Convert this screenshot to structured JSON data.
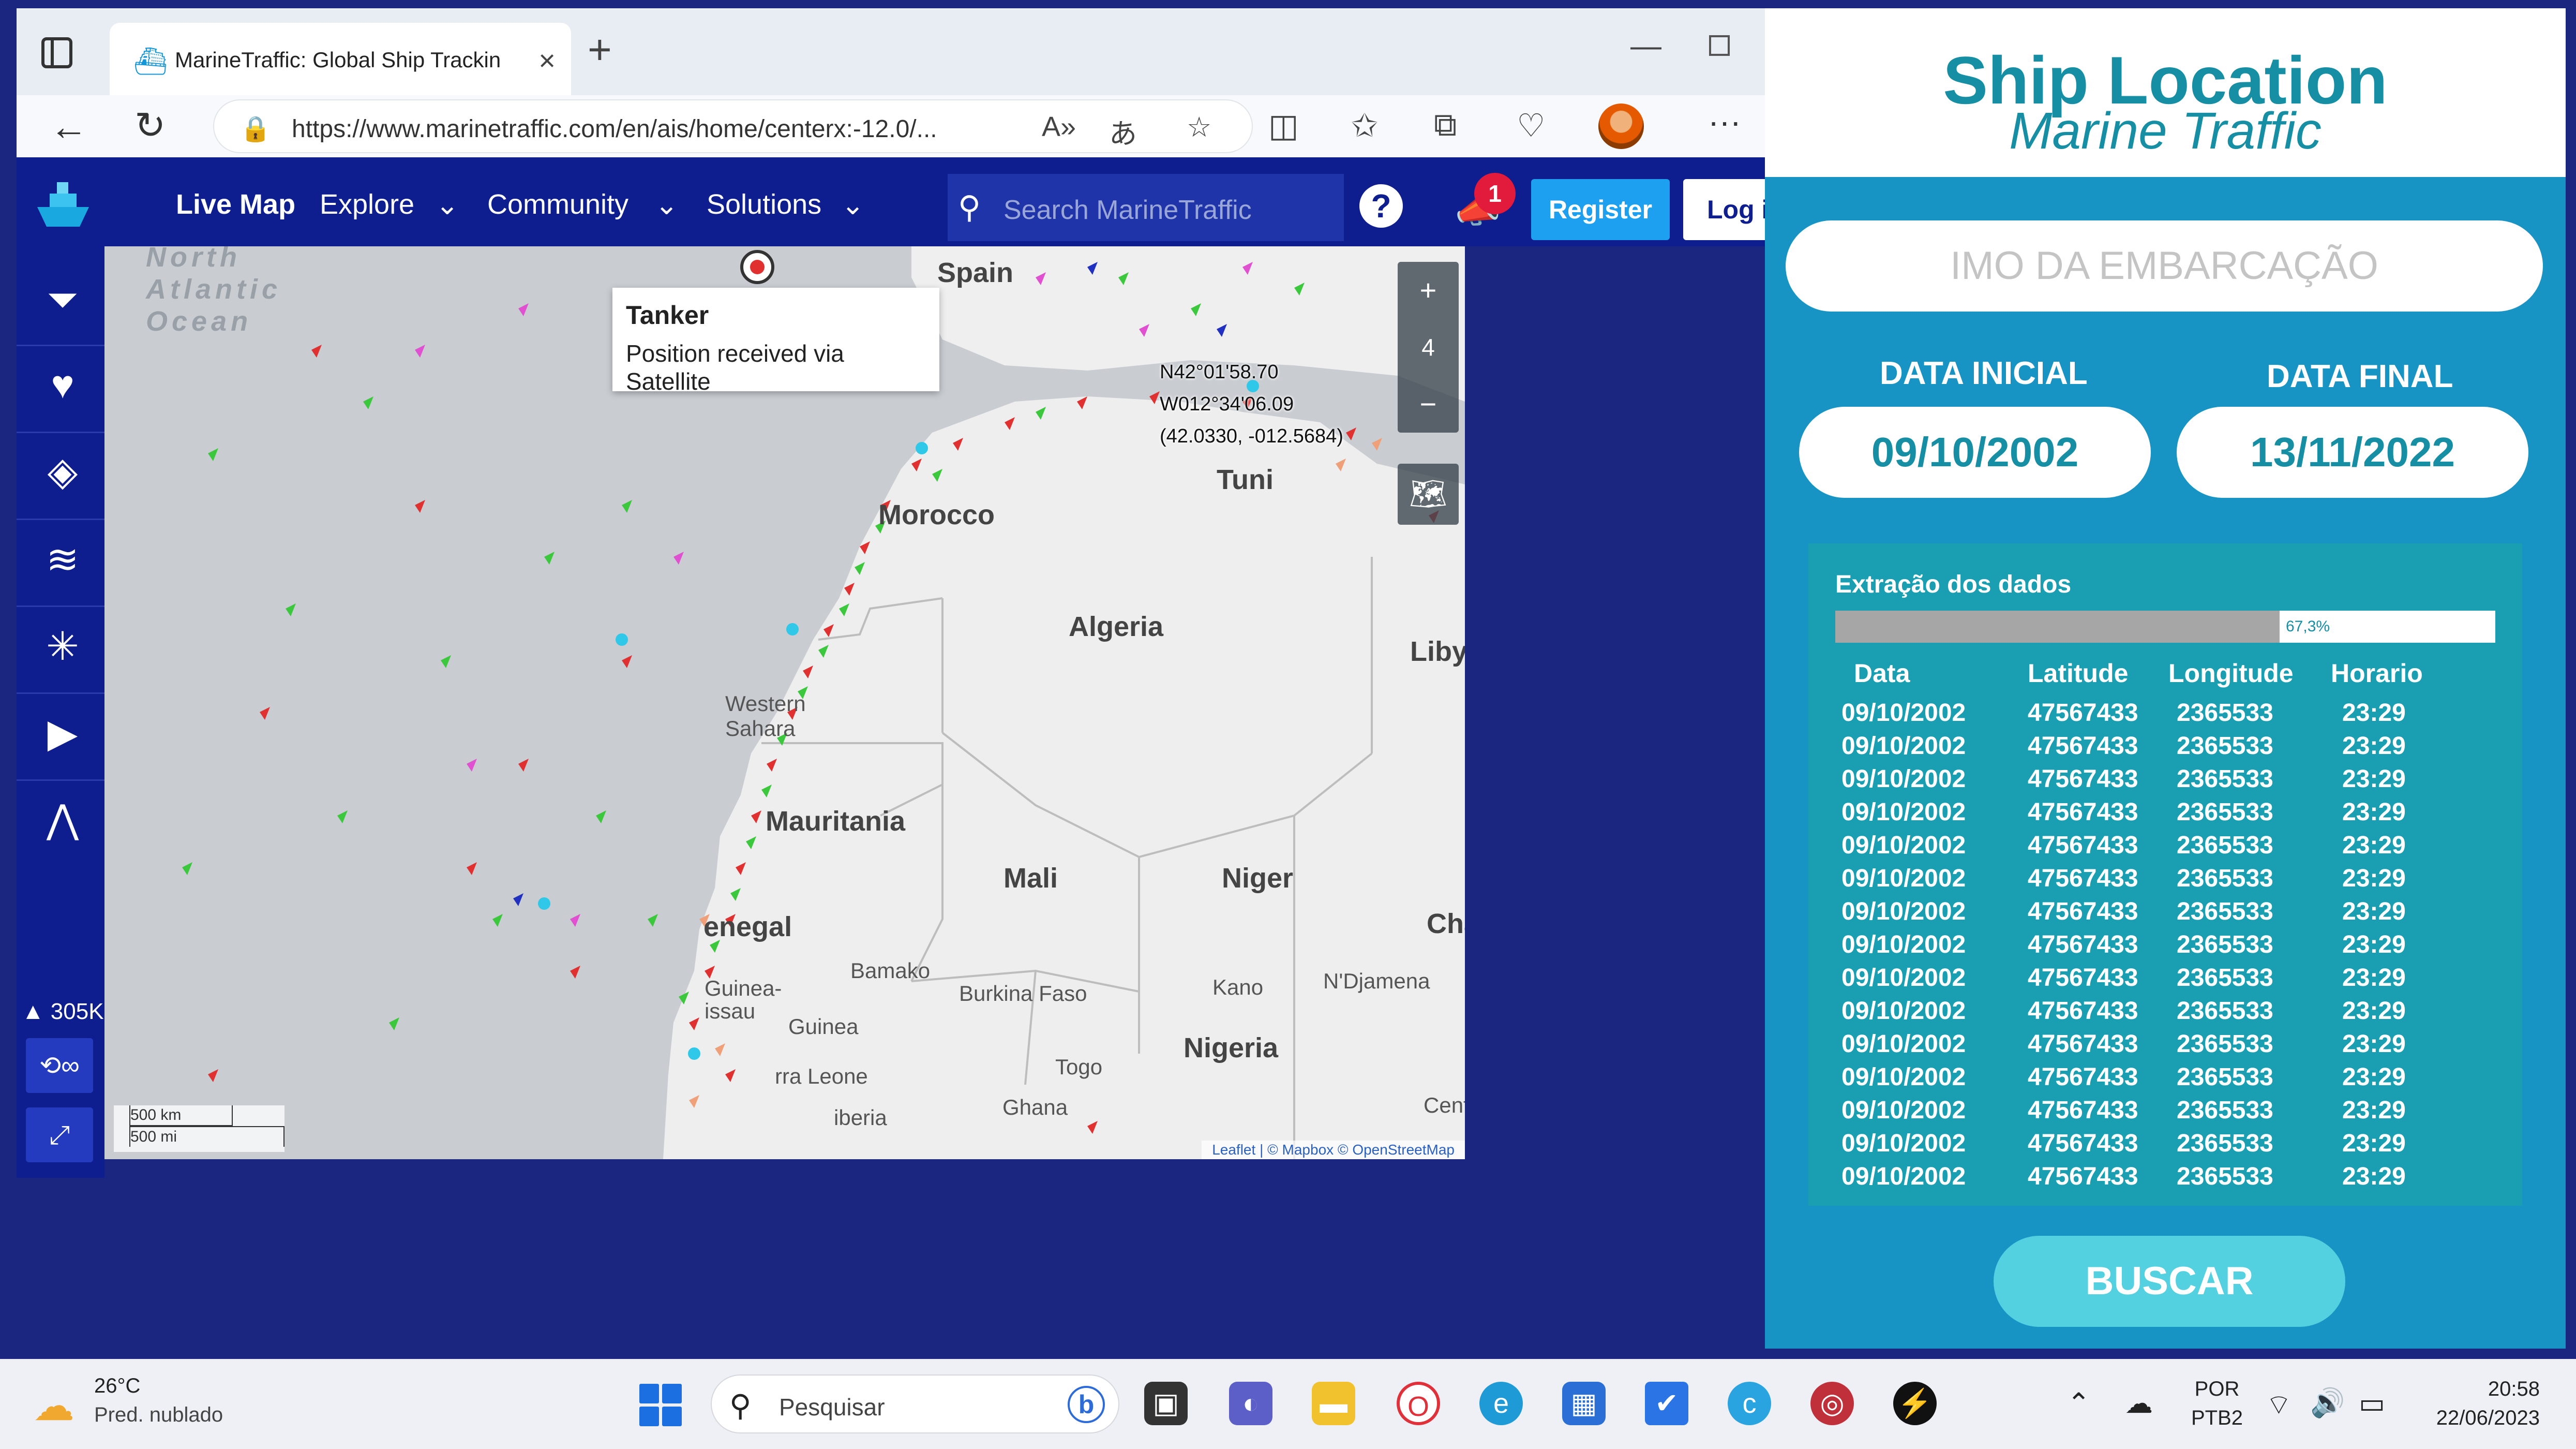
{
  "browser": {
    "tab_title": "MarineTraffic: Global Ship Trackin",
    "url": "https://www.marinetraffic.com/en/ais/home/centerx:-12.0/..."
  },
  "marinetraffic": {
    "nav": [
      "Live Map",
      "Explore",
      "Community",
      "Solutions"
    ],
    "search_placeholder": "Search MarineTraffic",
    "help": "?",
    "notification_count": "1",
    "register": "Register",
    "login": "Log i",
    "vessel_count": "305K",
    "loop_btn": "∞"
  },
  "map": {
    "tooltip_title": "Tanker",
    "tooltip_body": "Position received via Satellite",
    "coords": [
      "N42°01'58.70",
      "W012°34'06.09",
      "(42.0330, -012.5684)"
    ],
    "zoom_level": "4",
    "labels": {
      "spain": "Spain",
      "morocco": "Morocco",
      "algeria": "Algeria",
      "libya": "Libya",
      "western_sahara": "Western\nSahara",
      "mauritania": "Mauritania",
      "mali": "Mali",
      "niger": "Niger",
      "senegal": "enegal",
      "burkina": "Burkina Faso",
      "guinea": "Guinea",
      "nigeria": "Nigeria",
      "togo": "Togo",
      "ghana": "Ghana",
      "bamako": "Bamako",
      "ndjamena": "N'Djamena",
      "kano": "Kano",
      "chad": "Cha",
      "tunis": "Tuni",
      "sierra": "rra Leone",
      "liberia": "iberia",
      "centr": "Centr",
      "guinea_bissau": "Guinea-\nissau",
      "north_atlantic": "North\nAtlantic\nOcean"
    },
    "scale_km": "500 km",
    "scale_mi": "500 mi",
    "attribution": "Leaflet | © Mapbox © OpenStreetMap"
  },
  "panel": {
    "title": "Ship Location",
    "subtitle": "Marine Traffic",
    "imo_placeholder": "IMO DA EMBARCAÇÃO",
    "start_label": "DATA INICIAL",
    "end_label": "DATA FINAL",
    "start_date": "09/10/2002",
    "end_date": "13/11/2022",
    "extraction_title": "Extração dos dados",
    "progress": 0.673,
    "progress_label": "67,3%",
    "columns": [
      "Data",
      "Latitude",
      "Longitude",
      "Horario"
    ],
    "rows": [
      [
        "09/10/2002",
        "47567433",
        "2365533",
        "23:29"
      ],
      [
        "09/10/2002",
        "47567433",
        "2365533",
        "23:29"
      ],
      [
        "09/10/2002",
        "47567433",
        "2365533",
        "23:29"
      ],
      [
        "09/10/2002",
        "47567433",
        "2365533",
        "23:29"
      ],
      [
        "09/10/2002",
        "47567433",
        "2365533",
        "23:29"
      ],
      [
        "09/10/2002",
        "47567433",
        "2365533",
        "23:29"
      ],
      [
        "09/10/2002",
        "47567433",
        "2365533",
        "23:29"
      ],
      [
        "09/10/2002",
        "47567433",
        "2365533",
        "23:29"
      ],
      [
        "09/10/2002",
        "47567433",
        "2365533",
        "23:29"
      ],
      [
        "09/10/2002",
        "47567433",
        "2365533",
        "23:29"
      ],
      [
        "09/10/2002",
        "47567433",
        "2365533",
        "23:29"
      ],
      [
        "09/10/2002",
        "47567433",
        "2365533",
        "23:29"
      ],
      [
        "09/10/2002",
        "47567433",
        "2365533",
        "23:29"
      ],
      [
        "09/10/2002",
        "47567433",
        "2365533",
        "23:29"
      ],
      [
        "09/10/2002",
        "47567433",
        "2365533",
        "23:29"
      ]
    ],
    "button": "BUSCAR",
    "accent": "#168ea4",
    "panel_bg": "#1793c4"
  },
  "taskbar": {
    "temp": "26°C",
    "weather": "Pred. nublado",
    "search": "Pesquisar",
    "lang1": "POR",
    "lang2": "PTB2",
    "time": "20:58",
    "date": "22/06/2023"
  }
}
